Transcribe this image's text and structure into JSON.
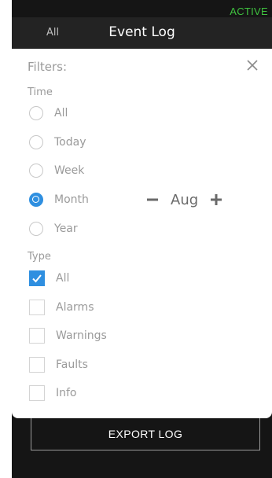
{
  "status": {
    "text": "ACTIVE",
    "color": "#3fc23f"
  },
  "header": {
    "filter_label": "All",
    "title": "Event Log"
  },
  "filters": {
    "title": "Filters:",
    "close_icon": "close-icon",
    "time": {
      "label": "Time",
      "options": [
        {
          "label": "All",
          "selected": false
        },
        {
          "label": "Today",
          "selected": false
        },
        {
          "label": "Week",
          "selected": false
        },
        {
          "label": "Month",
          "selected": true
        },
        {
          "label": "Year",
          "selected": false
        }
      ],
      "month_value": "Aug",
      "decrement_icon": "minus-icon",
      "increment_icon": "plus-icon"
    },
    "type": {
      "label": "Type",
      "options": [
        {
          "label": "All",
          "checked": true
        },
        {
          "label": "Alarms",
          "checked": false
        },
        {
          "label": "Warnings",
          "checked": false
        },
        {
          "label": "Faults",
          "checked": false
        },
        {
          "label": "Info",
          "checked": false
        }
      ]
    }
  },
  "actions": {
    "export_label": "EXPORT LOG"
  },
  "colors": {
    "accent": "#2f8fe0",
    "background": "#151515",
    "header": "#232323"
  }
}
